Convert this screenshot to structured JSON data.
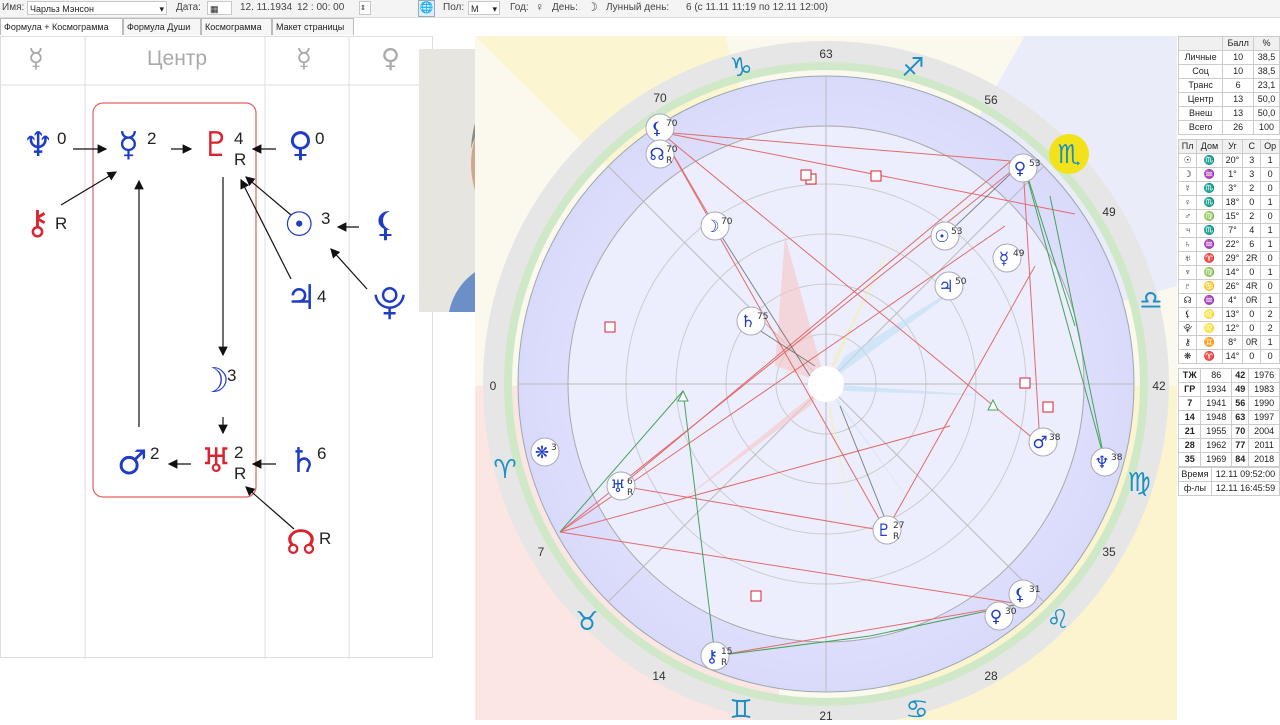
{
  "topbar": {
    "name_label": "Имя:",
    "name_value": "Чарльз Мэнсон",
    "date_label": "Дата:",
    "date_value": "12. 11.1934",
    "time_value": "12 : 00: 00",
    "sex_label": "Пол:",
    "sex_value": "М",
    "year_label": "Год:",
    "day_label": "День:",
    "lunar_label": "Лунный день:",
    "lunar_value": "6 (с 11.11 11:19 по 12.11 12:00)"
  },
  "tabs": [
    "Формула + Космограмма",
    "Формула Души",
    "Космограмма",
    "Макет страницы"
  ],
  "formula": {
    "col_headers": [
      "☿",
      "Центр",
      "☿",
      "♀"
    ],
    "items": [
      {
        "glyph": "♆",
        "num": "0",
        "color": "blue"
      },
      {
        "glyph": "☿",
        "num": "2",
        "color": "blue"
      },
      {
        "glyph": "♇",
        "num": "4",
        "sub": "R",
        "color": "red"
      },
      {
        "glyph": "♀",
        "num": "0",
        "color": "blue"
      },
      {
        "glyph": "⚷",
        "num": "R",
        "color": "red"
      },
      {
        "glyph": "☉",
        "num": "3",
        "color": "blue"
      },
      {
        "glyph": "⚸",
        "num": "",
        "color": "blue"
      },
      {
        "glyph": "♃",
        "num": "4",
        "color": "blue"
      },
      {
        "glyph": "⯓",
        "num": "",
        "color": "blue"
      },
      {
        "glyph": "☽",
        "num": "3",
        "color": "blue"
      },
      {
        "glyph": "♂",
        "num": "2",
        "color": "blue"
      },
      {
        "glyph": "♅",
        "num": "2",
        "sub": "R",
        "color": "red"
      },
      {
        "glyph": "♄",
        "num": "6",
        "color": "blue"
      },
      {
        "glyph": "☊",
        "num": "R",
        "color": "red"
      }
    ]
  },
  "chart": {
    "degree_labels": [
      "63",
      "56",
      "49",
      "42",
      "35",
      "28",
      "21",
      "14",
      "7",
      "0",
      "70"
    ],
    "sign_glyphs": [
      "♑",
      "♐",
      "♏",
      "♎",
      "♍",
      "♌",
      "♋",
      "♊",
      "♉",
      "♈",
      "♓",
      "♒"
    ],
    "planets": [
      {
        "g": "⚸",
        "d": "70",
        "sub": ""
      },
      {
        "g": "☊",
        "d": "70",
        "sub": "R"
      },
      {
        "g": "☽",
        "d": "70",
        "sub": ""
      },
      {
        "g": "☉",
        "d": "53",
        "sub": ""
      },
      {
        "g": "♀",
        "d": "53",
        "sub": ""
      },
      {
        "g": "☿",
        "d": "49",
        "sub": ""
      },
      {
        "g": "♃",
        "d": "50",
        "sub": ""
      },
      {
        "g": "♄",
        "d": "75",
        "sub": ""
      },
      {
        "g": "♂",
        "d": "38",
        "sub": ""
      },
      {
        "g": "♆",
        "d": "38",
        "sub": ""
      },
      {
        "g": "❋",
        "d": "3",
        "sub": ""
      },
      {
        "g": "♅",
        "d": "6",
        "sub": "R"
      },
      {
        "g": "♇",
        "d": "27",
        "sub": "R"
      },
      {
        "g": "⚸",
        "d": "31",
        "sub": ""
      },
      {
        "g": "♀",
        "d": "30",
        "sub": ""
      },
      {
        "g": "⚷",
        "d": "15",
        "sub": "R"
      }
    ]
  },
  "score_table": {
    "headers": [
      "",
      "Балл",
      "%"
    ],
    "rows": [
      [
        "Личные",
        "10",
        "38,5"
      ],
      [
        "Соц",
        "10",
        "38,5"
      ],
      [
        "Транс",
        "6",
        "23,1"
      ],
      [
        "Центр",
        "13",
        "50,0"
      ],
      [
        "Внеш",
        "13",
        "50,0"
      ],
      [
        "Всего",
        "26",
        "100"
      ]
    ]
  },
  "planet_table": {
    "headers": [
      "Пл",
      "Дом",
      "Уг",
      "С",
      "Ор"
    ],
    "rows": [
      [
        "☉",
        "♏",
        "20°",
        "3",
        "1"
      ],
      [
        "☽",
        "♒",
        "1°",
        "3",
        "0"
      ],
      [
        "☿",
        "♏",
        "3°",
        "2",
        "0"
      ],
      [
        "♀",
        "♏",
        "18°",
        "0",
        "1"
      ],
      [
        "♂",
        "♍",
        "15°",
        "2",
        "0"
      ],
      [
        "♃",
        "♏",
        "7°",
        "4",
        "1"
      ],
      [
        "♄",
        "♒",
        "22°",
        "6",
        "1"
      ],
      [
        "♅",
        "♈",
        "29°",
        "2R",
        "0"
      ],
      [
        "♆",
        "♍",
        "14°",
        "0",
        "1"
      ],
      [
        "♇",
        "♋",
        "26°",
        "4R",
        "0"
      ],
      [
        "☊",
        "♒",
        "4°",
        "0R",
        "1"
      ],
      [
        "⚸",
        "♌",
        "13°",
        "0",
        "2"
      ],
      [
        "⯓",
        "♌",
        "12°",
        "0",
        "2"
      ],
      [
        "⚷",
        "♊",
        "8°",
        "0R",
        "1"
      ],
      [
        "❋",
        "♈",
        "14°",
        "0",
        "0"
      ]
    ]
  },
  "cycle_table": {
    "rows": [
      [
        "ТЖ",
        "86",
        "42",
        "1976"
      ],
      [
        "ГР",
        "1934",
        "49",
        "1983"
      ],
      [
        "7",
        "1941",
        "56",
        "1990"
      ],
      [
        "14",
        "1948",
        "63",
        "1997"
      ],
      [
        "21",
        "1955",
        "70",
        "2004"
      ],
      [
        "28",
        "1962",
        "77",
        "2011"
      ],
      [
        "35",
        "1969",
        "84",
        "2018"
      ]
    ]
  },
  "footer_table": {
    "rows": [
      [
        "Время",
        "12.11 09:52:00"
      ],
      [
        "ф-лы",
        "12.11 16:45:59"
      ]
    ]
  },
  "colors": {
    "blue": "#1f3cc6",
    "red": "#d9232f"
  }
}
